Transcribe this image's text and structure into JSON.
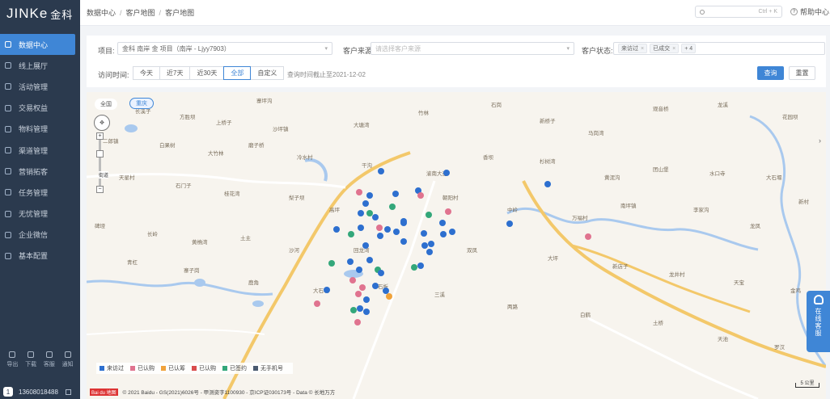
{
  "app": {
    "logo_text": "JINKe",
    "logo_cn": "金科"
  },
  "sidebar": {
    "items": [
      {
        "label": "数据中心",
        "active": true
      },
      {
        "label": "线上展厅"
      },
      {
        "label": "活动管理"
      },
      {
        "label": "交易权益"
      },
      {
        "label": "物料管理"
      },
      {
        "label": "渠道管理"
      },
      {
        "label": "营销拓客"
      },
      {
        "label": "任务管理"
      },
      {
        "label": "无忧管理"
      },
      {
        "label": "企业微信"
      },
      {
        "label": "基本配置"
      }
    ],
    "tools": [
      {
        "label": "导出"
      },
      {
        "label": "下载"
      },
      {
        "label": "客服"
      },
      {
        "label": "通知"
      }
    ],
    "user": {
      "badge": "1",
      "phone": "13608018488"
    }
  },
  "header": {
    "breadcrumbs": [
      "数据中心",
      "客户地图",
      "客户地图"
    ],
    "search_placeholder": "",
    "search_shortcut": "Ctrl + K",
    "help_label": "帮助中心"
  },
  "filters": {
    "project_label": "项目:",
    "project_value": "金科 南岸 金 项目（南岸 - Ljyy7903）",
    "source_label": "客户来源:",
    "source_placeholder": "请选择客户来源",
    "status_label": "客户状态:",
    "status_tags": [
      "来访过",
      "已成交",
      "+ 4"
    ],
    "time_label": "访问时间:",
    "time_options": [
      "今天",
      "近7天",
      "近30天",
      "全部",
      "自定义"
    ],
    "time_selected": "全部",
    "date_note": "查询时间截止至2021-12-02",
    "query_button": "查询",
    "reset_button": "重置"
  },
  "map": {
    "tabs": [
      {
        "label": "全国"
      },
      {
        "label": "重庆",
        "active": true
      }
    ],
    "zoom_label": "街道",
    "legend": [
      {
        "label": "来访过",
        "color": "#2d6fcf"
      },
      {
        "label": "已认购",
        "color": "#e0738f"
      },
      {
        "label": "已认筹",
        "color": "#f0a23a"
      },
      {
        "label": "已认购",
        "color": "#d94c4c"
      },
      {
        "label": "已签约",
        "color": "#33a77a"
      },
      {
        "label": "无手机号",
        "color": "#4a5a70"
      }
    ],
    "copyright": "© 2021 Baidu - GS(2021)6026号 - 甲测资字1100930 - 京ICP证030173号 - Data © 长地万方",
    "copyright_logo": "Bai du 地图",
    "scale_label": "5 公里",
    "places": [
      "寨坪沟",
      "长溪子",
      "方胜坝",
      "上桥子",
      "沙坪镇",
      "大塘湾",
      "竹林",
      "石岗",
      "新桥子",
      "马岗湾",
      "观音桥",
      "龙溪",
      "花园坝",
      "二郎镇",
      "白果树",
      "大竹林",
      "磨子桥",
      "冷水村",
      "干沟",
      "渝南大道",
      "香坝",
      "杉树湾",
      "黄泥沟",
      "团山堡",
      "水口寺",
      "大石堰",
      "新村",
      "天星村",
      "石门子",
      "桂花湾",
      "梨子坝",
      "高坪",
      "朝阳村",
      "中岭",
      "万福村",
      "南坪镇",
      "李家沟",
      "龙凤",
      "碑垭",
      "长岭",
      "黄桷湾",
      "土主",
      "沙河",
      "回龙湾",
      "双凤",
      "大坪",
      "新店子",
      "龙井村",
      "天宝",
      "金鸡",
      "青杠",
      "寨子岗",
      "鹿角",
      "大石坝",
      "石板",
      "三溪",
      "两路",
      "白鹤",
      "土桥",
      "天池",
      "罗汉"
    ]
  },
  "service": {
    "label": "在线客服"
  }
}
